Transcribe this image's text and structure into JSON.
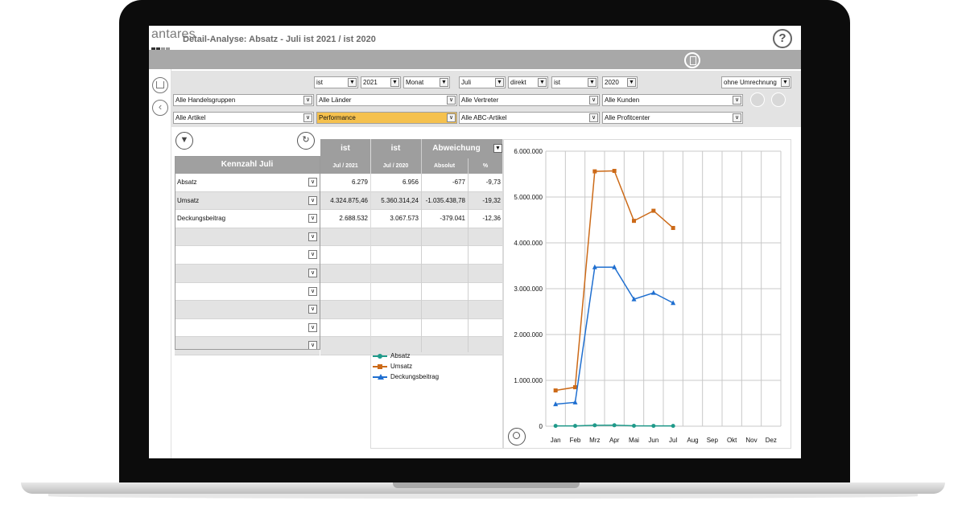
{
  "app": {
    "logo": "antares",
    "title": "Detail-Analyse: Absatz - Juli  ist 2021 / ist 2020",
    "help_label": "?"
  },
  "filters": {
    "row1": [
      {
        "value": "ist"
      },
      {
        "value": "2021"
      },
      {
        "value": "Monat"
      },
      {
        "value": "Juli"
      },
      {
        "value": "direkt"
      },
      {
        "value": "ist"
      },
      {
        "value": "2020"
      },
      {
        "value": "ohne Umrechnung"
      }
    ],
    "row2": [
      {
        "value": "Alle Handelsgruppen"
      },
      {
        "value": "Alle Länder"
      },
      {
        "value": "Alle Vertreter"
      },
      {
        "value": "Alle Kunden"
      }
    ],
    "row3": [
      {
        "value": "Alle Artikel"
      },
      {
        "value": "Performance"
      },
      {
        "value": "Alle ABC-Artikel"
      },
      {
        "value": "Alle Profitcenter"
      }
    ],
    "highlight_color": "#f5c14e"
  },
  "table": {
    "kennzahl_header": "Kennzahl Juli",
    "columns": [
      {
        "top": "ist",
        "sub": "Jul / 2021"
      },
      {
        "top": "ist",
        "sub": "Jul / 2020"
      },
      {
        "top": "Abweichung",
        "sub": "Absolut"
      },
      {
        "top": "",
        "sub": "%"
      }
    ],
    "rows": [
      {
        "label": "Absatz",
        "v2021": "6.279",
        "v2020": "6.956",
        "abs": "-677",
        "pct": "-9,73"
      },
      {
        "label": "Umsatz",
        "v2021": "4.324.875,46",
        "v2020": "5.360.314,24",
        "abs": "-1.035.438,78",
        "pct": "-19,32"
      },
      {
        "label": "Deckungsbeitrag",
        "v2021": "2.688.532",
        "v2020": "3.067.573",
        "abs": "-379.041",
        "pct": "-12,36"
      },
      {
        "label": "",
        "v2021": "",
        "v2020": "",
        "abs": "",
        "pct": ""
      },
      {
        "label": "",
        "v2021": "",
        "v2020": "",
        "abs": "",
        "pct": ""
      },
      {
        "label": "",
        "v2021": "",
        "v2020": "",
        "abs": "",
        "pct": ""
      },
      {
        "label": "",
        "v2021": "",
        "v2020": "",
        "abs": "",
        "pct": ""
      },
      {
        "label": "",
        "v2021": "",
        "v2020": "",
        "abs": "",
        "pct": ""
      },
      {
        "label": "",
        "v2021": "",
        "v2020": "",
        "abs": "",
        "pct": ""
      },
      {
        "label": "",
        "v2021": "",
        "v2020": "",
        "abs": "",
        "pct": ""
      }
    ]
  },
  "chart_data": {
    "type": "line",
    "categories": [
      "Jan",
      "Feb",
      "Mrz",
      "Apr",
      "Mai",
      "Jun",
      "Jul",
      "Aug",
      "Sep",
      "Okt",
      "Nov",
      "Dez"
    ],
    "ylim": [
      0,
      6000000
    ],
    "yticks": [
      0,
      1000000,
      2000000,
      3000000,
      4000000,
      5000000,
      6000000
    ],
    "ytick_labels": [
      "0",
      "1.000.000",
      "2.000.000",
      "3.000.000",
      "4.000.000",
      "5.000.000",
      "6.000.000"
    ],
    "grid": true,
    "legend_position": "outside-left-bottom",
    "series": [
      {
        "name": "Absatz",
        "color": "#1f9a8a",
        "marker": "circle",
        "values": [
          6000,
          6500,
          20000,
          21000,
          8000,
          7500,
          6279
        ]
      },
      {
        "name": "Umsatz",
        "color": "#cc6a18",
        "marker": "square",
        "values": [
          780000,
          850000,
          5560000,
          5570000,
          4480000,
          4700000,
          4324875
        ]
      },
      {
        "name": "Deckungsbeitrag",
        "color": "#1f6fd0",
        "marker": "triangle",
        "values": [
          480000,
          520000,
          3470000,
          3470000,
          2770000,
          2910000,
          2688532
        ]
      }
    ]
  }
}
